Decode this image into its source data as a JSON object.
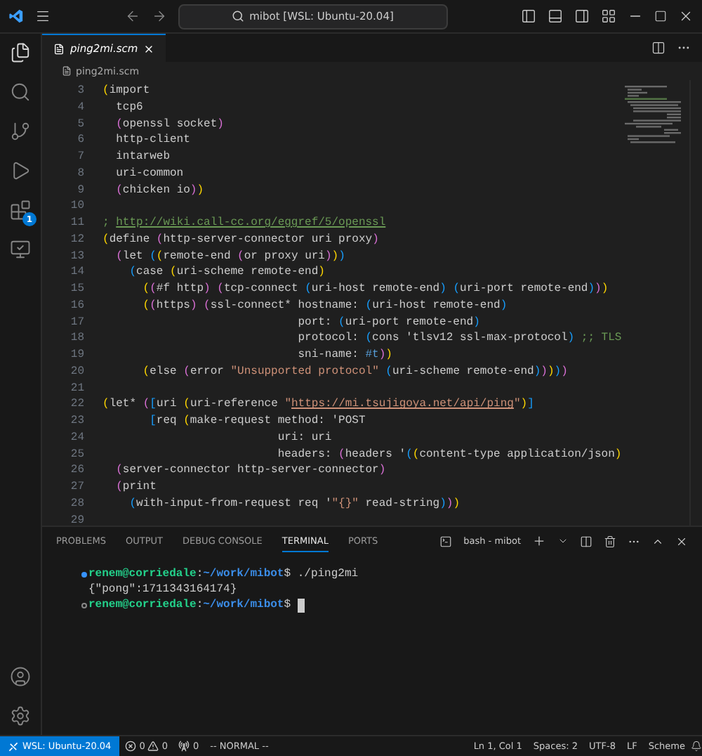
{
  "title_bar": {
    "search": "mibot [WSL: Ubuntu-20.04]"
  },
  "activity_bar": {
    "extensions_badge": "1"
  },
  "tabs": [
    {
      "label": "ping2mi.scm",
      "selected": true
    }
  ],
  "breadcrumb": "ping2mi.scm",
  "code_lines": [
    {
      "number": "3",
      "tokens": [
        {
          "text": "(",
          "kind": "bracket1"
        },
        {
          "text": "import",
          "kind": "plain"
        }
      ]
    },
    {
      "number": "4",
      "tokens": [
        {
          "text": "  tcp6",
          "kind": "plain"
        }
      ]
    },
    {
      "number": "5",
      "tokens": [
        {
          "text": "  (",
          "kind": "bracket2"
        },
        {
          "text": "openssl socket",
          "kind": "plain"
        },
        {
          "text": ")",
          "kind": "bracket2"
        }
      ]
    },
    {
      "number": "6",
      "tokens": [
        {
          "text": "  http-client",
          "kind": "plain"
        }
      ]
    },
    {
      "number": "7",
      "tokens": [
        {
          "text": "  intarweb",
          "kind": "plain"
        }
      ]
    },
    {
      "number": "8",
      "tokens": [
        {
          "text": "  uri-common",
          "kind": "plain"
        }
      ]
    },
    {
      "number": "9",
      "tokens": [
        {
          "text": "  (",
          "kind": "bracket2"
        },
        {
          "text": "chicken io",
          "kind": "plain"
        },
        {
          "text": ")",
          "kind": "bracket2"
        },
        {
          "text": ")",
          "kind": "bracket1"
        }
      ]
    },
    {
      "number": "10"
    },
    {
      "number": "11",
      "tokens": [
        {
          "text": "; ",
          "kind": "comment"
        },
        {
          "text": "http://wiki.call-cc.org/eggref/5/openssl",
          "kind": "comment_link"
        }
      ]
    },
    {
      "number": "12",
      "tokens": [
        {
          "text": "(",
          "kind": "bracket1"
        },
        {
          "text": "define ",
          "kind": "plain"
        },
        {
          "text": "(",
          "kind": "bracket2"
        },
        {
          "text": "http-server-connector uri proxy",
          "kind": "plain"
        },
        {
          "text": ")",
          "kind": "bracket2"
        }
      ]
    },
    {
      "number": "13",
      "tokens": [
        {
          "text": "  (",
          "kind": "bracket2"
        },
        {
          "text": "let ",
          "kind": "plain"
        },
        {
          "text": "(",
          "kind": "bracket3"
        },
        {
          "text": "(",
          "kind": "bracket1"
        },
        {
          "text": "remote-end ",
          "kind": "plain"
        },
        {
          "text": "(",
          "kind": "bracket2"
        },
        {
          "text": "or proxy uri",
          "kind": "plain"
        },
        {
          "text": ")",
          "kind": "bracket2"
        },
        {
          "text": ")",
          "kind": "bracket1"
        },
        {
          "text": ")",
          "kind": "bracket3"
        }
      ]
    },
    {
      "number": "14",
      "tokens": [
        {
          "text": "    (",
          "kind": "bracket3"
        },
        {
          "text": "case ",
          "kind": "plain"
        },
        {
          "text": "(",
          "kind": "bracket1"
        },
        {
          "text": "uri-scheme remote-end",
          "kind": "plain"
        },
        {
          "text": ")",
          "kind": "bracket1"
        }
      ]
    },
    {
      "number": "15",
      "tokens": [
        {
          "text": "      (",
          "kind": "bracket1"
        },
        {
          "text": "(",
          "kind": "bracket2"
        },
        {
          "text": "#f http",
          "kind": "plain"
        },
        {
          "text": ")",
          "kind": "bracket2"
        },
        {
          "text": " (",
          "kind": "bracket2"
        },
        {
          "text": "tcp-connect ",
          "kind": "plain"
        },
        {
          "text": "(",
          "kind": "bracket3"
        },
        {
          "text": "uri-host remote-end",
          "kind": "plain"
        },
        {
          "text": ")",
          "kind": "bracket3"
        },
        {
          "text": " (",
          "kind": "bracket3"
        },
        {
          "text": "uri-port remote-end",
          "kind": "plain"
        },
        {
          "text": ")",
          "kind": "bracket3"
        },
        {
          "text": ")",
          "kind": "bracket2"
        },
        {
          "text": ")",
          "kind": "bracket1"
        }
      ]
    },
    {
      "number": "16",
      "tokens": [
        {
          "text": "      (",
          "kind": "bracket1"
        },
        {
          "text": "(",
          "kind": "bracket2"
        },
        {
          "text": "https",
          "kind": "plain"
        },
        {
          "text": ")",
          "kind": "bracket2"
        },
        {
          "text": " (",
          "kind": "bracket2"
        },
        {
          "text": "ssl-connect* hostname: ",
          "kind": "plain"
        },
        {
          "text": "(",
          "kind": "bracket3"
        },
        {
          "text": "uri-host remote-end",
          "kind": "plain"
        },
        {
          "text": ")",
          "kind": "bracket3"
        }
      ]
    },
    {
      "number": "17",
      "tokens": [
        {
          "text": "                             port: ",
          "kind": "plain"
        },
        {
          "text": "(",
          "kind": "bracket3"
        },
        {
          "text": "uri-port remote-end",
          "kind": "plain"
        },
        {
          "text": ")",
          "kind": "bracket3"
        }
      ]
    },
    {
      "number": "18",
      "tokens": [
        {
          "text": "                             protocol: ",
          "kind": "plain"
        },
        {
          "text": "(",
          "kind": "bracket3"
        },
        {
          "text": "cons 'tlsv12 ssl-max-protocol",
          "kind": "plain"
        },
        {
          "text": ")",
          "kind": "bracket3"
        },
        {
          "text": " ;; TLS",
          "kind": "comment"
        }
      ]
    },
    {
      "number": "19",
      "tokens": [
        {
          "text": "                             sni-name: ",
          "kind": "plain"
        },
        {
          "text": "#t",
          "kind": "constant"
        },
        {
          "text": ")",
          "kind": "bracket2"
        },
        {
          "text": ")",
          "kind": "bracket1"
        }
      ]
    },
    {
      "number": "20",
      "tokens": [
        {
          "text": "      (",
          "kind": "bracket1"
        },
        {
          "text": "else ",
          "kind": "plain"
        },
        {
          "text": "(",
          "kind": "bracket2"
        },
        {
          "text": "error ",
          "kind": "plain"
        },
        {
          "text": "\"Unsupported protocol\"",
          "kind": "string"
        },
        {
          "text": " (",
          "kind": "bracket3"
        },
        {
          "text": "uri-scheme remote-end",
          "kind": "plain"
        },
        {
          "text": ")",
          "kind": "bracket3"
        },
        {
          "text": ")",
          "kind": "bracket2"
        },
        {
          "text": ")",
          "kind": "bracket1"
        },
        {
          "text": ")",
          "kind": "bracket3"
        },
        {
          "text": ")",
          "kind": "bracket2"
        }
      ]
    },
    {
      "number": "21"
    },
    {
      "number": "22",
      "tokens": [
        {
          "text": "(",
          "kind": "bracket1"
        },
        {
          "text": "let* ",
          "kind": "plain"
        },
        {
          "text": "(",
          "kind": "bracket2"
        },
        {
          "text": "[",
          "kind": "bracket3"
        },
        {
          "text": "uri ",
          "kind": "plain"
        },
        {
          "text": "(",
          "kind": "bracket1"
        },
        {
          "text": "uri-reference ",
          "kind": "plain"
        },
        {
          "text": "\"",
          "kind": "string"
        },
        {
          "text": "https://mi.tsujigoya.net/api/ping",
          "kind": "string_link"
        },
        {
          "text": "\"",
          "kind": "string"
        },
        {
          "text": ")",
          "kind": "bracket1"
        },
        {
          "text": "]",
          "kind": "bracket3"
        }
      ]
    },
    {
      "number": "23",
      "tokens": [
        {
          "text": "       [",
          "kind": "bracket3"
        },
        {
          "text": "req ",
          "kind": "plain"
        },
        {
          "text": "(",
          "kind": "bracket1"
        },
        {
          "text": "make-request method: 'POST",
          "kind": "plain"
        }
      ]
    },
    {
      "number": "24",
      "tokens": [
        {
          "text": "                          uri: uri",
          "kind": "plain"
        }
      ]
    },
    {
      "number": "25",
      "tokens": [
        {
          "text": "                          headers: ",
          "kind": "plain"
        },
        {
          "text": "(",
          "kind": "bracket2"
        },
        {
          "text": "headers '",
          "kind": "plain"
        },
        {
          "text": "(",
          "kind": "bracket3"
        },
        {
          "text": "(",
          "kind": "bracket1"
        },
        {
          "text": "content-type application/json",
          "kind": "plain"
        },
        {
          "text": ")",
          "kind": "bracket1"
        }
      ]
    },
    {
      "number": "26",
      "tokens": [
        {
          "text": "  (",
          "kind": "bracket2"
        },
        {
          "text": "server-connector http-server-connector",
          "kind": "plain"
        },
        {
          "text": ")",
          "kind": "bracket2"
        }
      ]
    },
    {
      "number": "27",
      "tokens": [
        {
          "text": "  (",
          "kind": "bracket2"
        },
        {
          "text": "print",
          "kind": "plain"
        }
      ]
    },
    {
      "number": "28",
      "tokens": [
        {
          "text": "    (",
          "kind": "bracket3"
        },
        {
          "text": "with-input-from-request req '",
          "kind": "plain"
        },
        {
          "text": "\"{}\"",
          "kind": "string"
        },
        {
          "text": " read-string",
          "kind": "plain"
        },
        {
          "text": ")",
          "kind": "bracket3"
        },
        {
          "text": ")",
          "kind": "bracket2"
        },
        {
          "text": ")",
          "kind": "bracket1"
        }
      ]
    },
    {
      "number": "29"
    }
  ],
  "panel": {
    "tabs": [
      {
        "label": "PROBLEMS",
        "selected": false
      },
      {
        "label": "OUTPUT",
        "selected": false
      },
      {
        "label": "DEBUG CONSOLE",
        "selected": false
      },
      {
        "label": "TERMINAL",
        "selected": true
      },
      {
        "label": "PORTS",
        "selected": false
      }
    ],
    "terminal_name": "bash - mibot",
    "lines": [
      {
        "kind": "prompt",
        "succeeded": true,
        "tokens": [
          {
            "text": "renem@corriedale",
            "kind": "user"
          },
          {
            "text": ":",
            "kind": "plain"
          },
          {
            "text": "~/work/mibot",
            "kind": "path"
          },
          {
            "text": "$ ./ping2mi",
            "kind": "plain"
          }
        ]
      },
      {
        "kind": "output",
        "tokens": [
          {
            "text": "{\"pong\":1711343164174}",
            "kind": "plain"
          }
        ]
      },
      {
        "kind": "prompt",
        "succeeded": false,
        "cursor": true,
        "tokens": [
          {
            "text": "renem@corriedale",
            "kind": "user"
          },
          {
            "text": ":",
            "kind": "plain"
          },
          {
            "text": "~/work/mibot",
            "kind": "path"
          },
          {
            "text": "$",
            "kind": "plain"
          }
        ]
      }
    ]
  },
  "status_bar": {
    "remote": "WSL: Ubuntu-20.04",
    "errors": "0",
    "warnings": "0",
    "ports": "0",
    "mode": "-- NORMAL --",
    "position": "Ln 1, Col 1",
    "spaces": "Spaces: 2",
    "encoding": "UTF-8",
    "eol": "LF",
    "language": "Scheme"
  }
}
